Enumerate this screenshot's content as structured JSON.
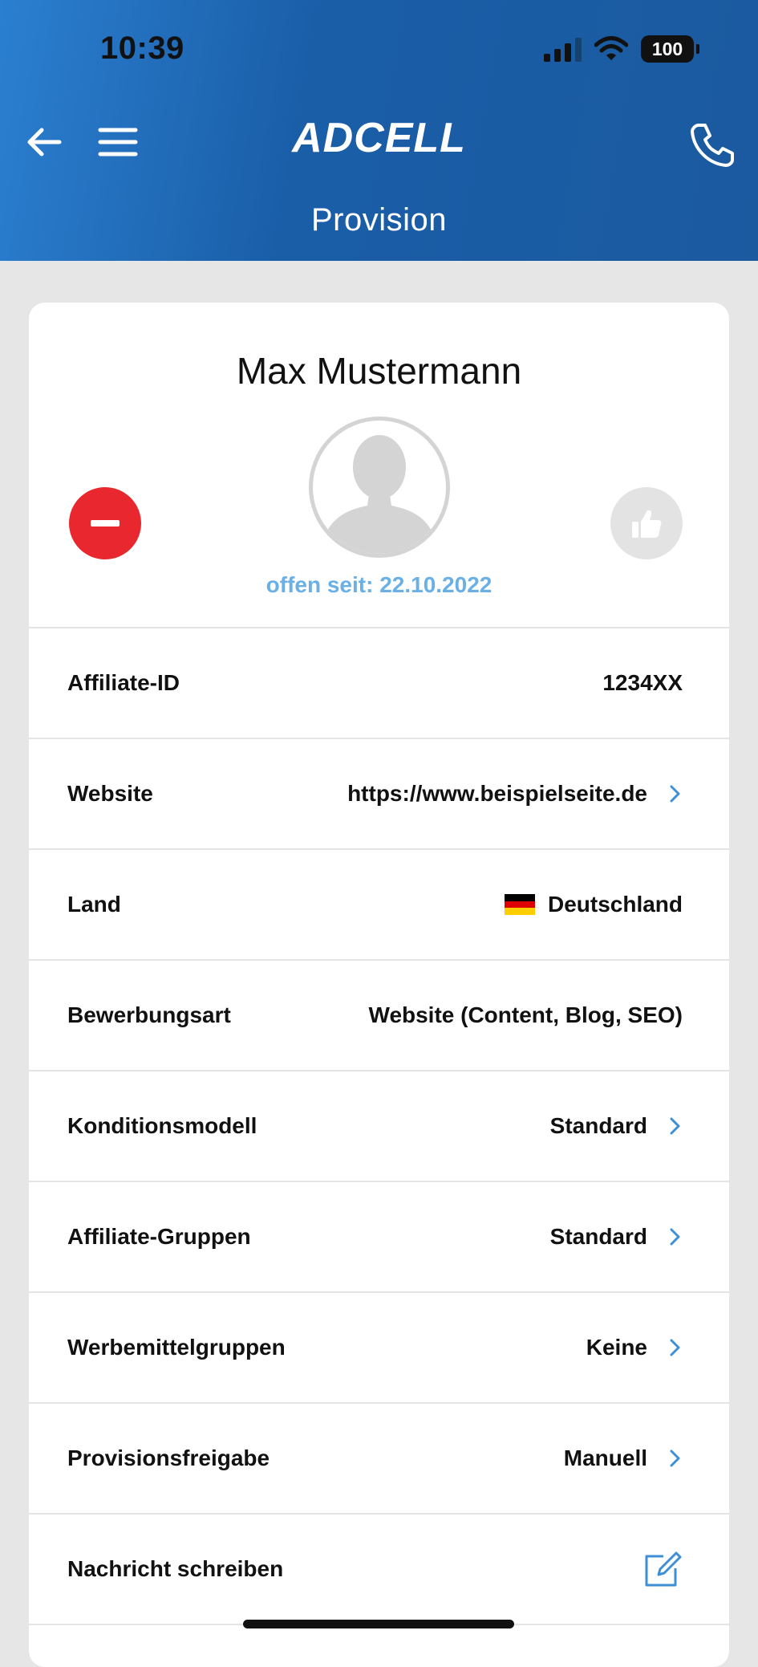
{
  "status_bar": {
    "time": "10:39",
    "battery": "100"
  },
  "nav": {
    "logo": "ADCELL",
    "title": "Provision"
  },
  "profile": {
    "name": "Max Mustermann",
    "since": "offen seit: 22.10.2022"
  },
  "rows": [
    {
      "label": "Affiliate-ID",
      "value": "1234XX"
    },
    {
      "label": "Website",
      "value": "https://www.beispielseite.de"
    },
    {
      "label": "Land",
      "value": "Deutschland"
    },
    {
      "label": "Bewerbungsart",
      "value": "Website (Content, Blog, SEO)"
    },
    {
      "label": "Konditionsmodell",
      "value": "Standard"
    },
    {
      "label": "Affiliate-Gruppen",
      "value": "Standard"
    },
    {
      "label": "Werbemittelgruppen",
      "value": "Keine"
    },
    {
      "label": "Provisionsfreigabe",
      "value": "Manuell"
    },
    {
      "label": "Nachricht schreiben"
    }
  ],
  "colors": {
    "header": "#1b5a9f",
    "accent": "#3d8fd6",
    "reject": "#e8282e",
    "since_text": "#6ab0e6"
  },
  "icons": {
    "back": "arrow-left-icon",
    "menu": "hamburger-icon",
    "phone": "phone-icon",
    "reject": "minus-icon",
    "approve": "thumbs-up-icon",
    "edit": "edit-icon"
  }
}
